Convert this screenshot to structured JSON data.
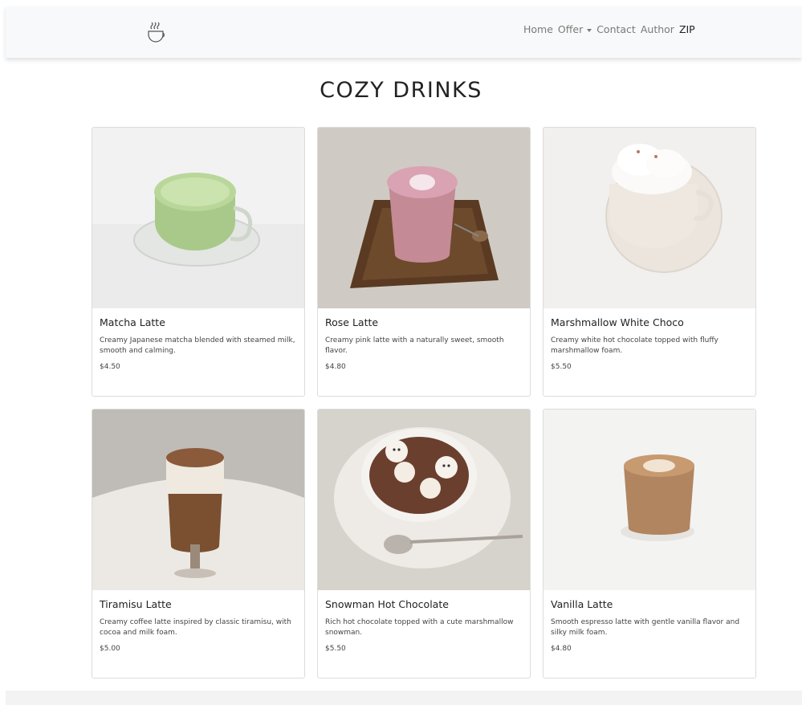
{
  "nav": {
    "brand_icon": "coffee-cup-icon",
    "links": {
      "home": "Home",
      "offer": "Offer",
      "contact": "Contact",
      "author": "Author",
      "zip": "ZIP"
    }
  },
  "page": {
    "title": "COZY DRINKS"
  },
  "products": [
    {
      "name": "Matcha Latte",
      "description": "Creamy Japanese matcha blended with steamed milk, smooth and calming.",
      "price": "$4.50"
    },
    {
      "name": "Rose Latte",
      "description": "Creamy pink latte with a naturally sweet, smooth flavor.",
      "price": "$4.80"
    },
    {
      "name": "Marshmallow White Choco",
      "description": "Creamy white hot chocolate topped with fluffy marshmallow foam.",
      "price": "$5.50"
    },
    {
      "name": "Tiramisu Latte",
      "description": "Creamy coffee latte inspired by classic tiramisu, with cocoa and milk foam.",
      "price": "$5.00"
    },
    {
      "name": "Snowman Hot Chocolate",
      "description": "Rich hot chocolate topped with a cute marshmallow snowman.",
      "price": "$5.50"
    },
    {
      "name": "Vanilla Latte",
      "description": "Smooth espresso latte with gentle vanilla flavor and silky milk foam.",
      "price": "$4.80"
    }
  ]
}
